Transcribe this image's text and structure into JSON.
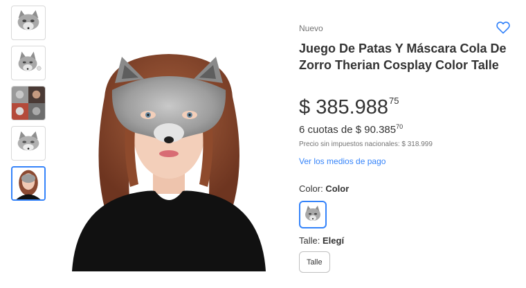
{
  "gallery": {
    "thumbnails": [
      {
        "alt": "mask-front"
      },
      {
        "alt": "mask-side"
      },
      {
        "alt": "costume-set"
      },
      {
        "alt": "mask-flat"
      },
      {
        "alt": "model-wearing-mask",
        "selected": true
      }
    ],
    "main_image_icon": "model-wearing-fox-mask"
  },
  "product": {
    "condition": "Nuevo",
    "title": "Juego De Patas Y Máscara Cola De Zorro Therian Cosplay Color Talle",
    "price": {
      "currency": "$",
      "integer": "385.988",
      "cents": "75"
    },
    "installments": {
      "text": "6 cuotas de $ 90.385",
      "cents": "70"
    },
    "taxless": "Precio sin impuestos nacionales: $ 318.999",
    "payment_link": "Ver los medios de pago"
  },
  "variations": {
    "color": {
      "label": "Color:",
      "value": "Color"
    },
    "size": {
      "label": "Talle:",
      "value": "Elegí",
      "option": "Talle"
    }
  },
  "colors": {
    "accent": "#3483fa",
    "text": "#333333",
    "muted": "#737373"
  }
}
